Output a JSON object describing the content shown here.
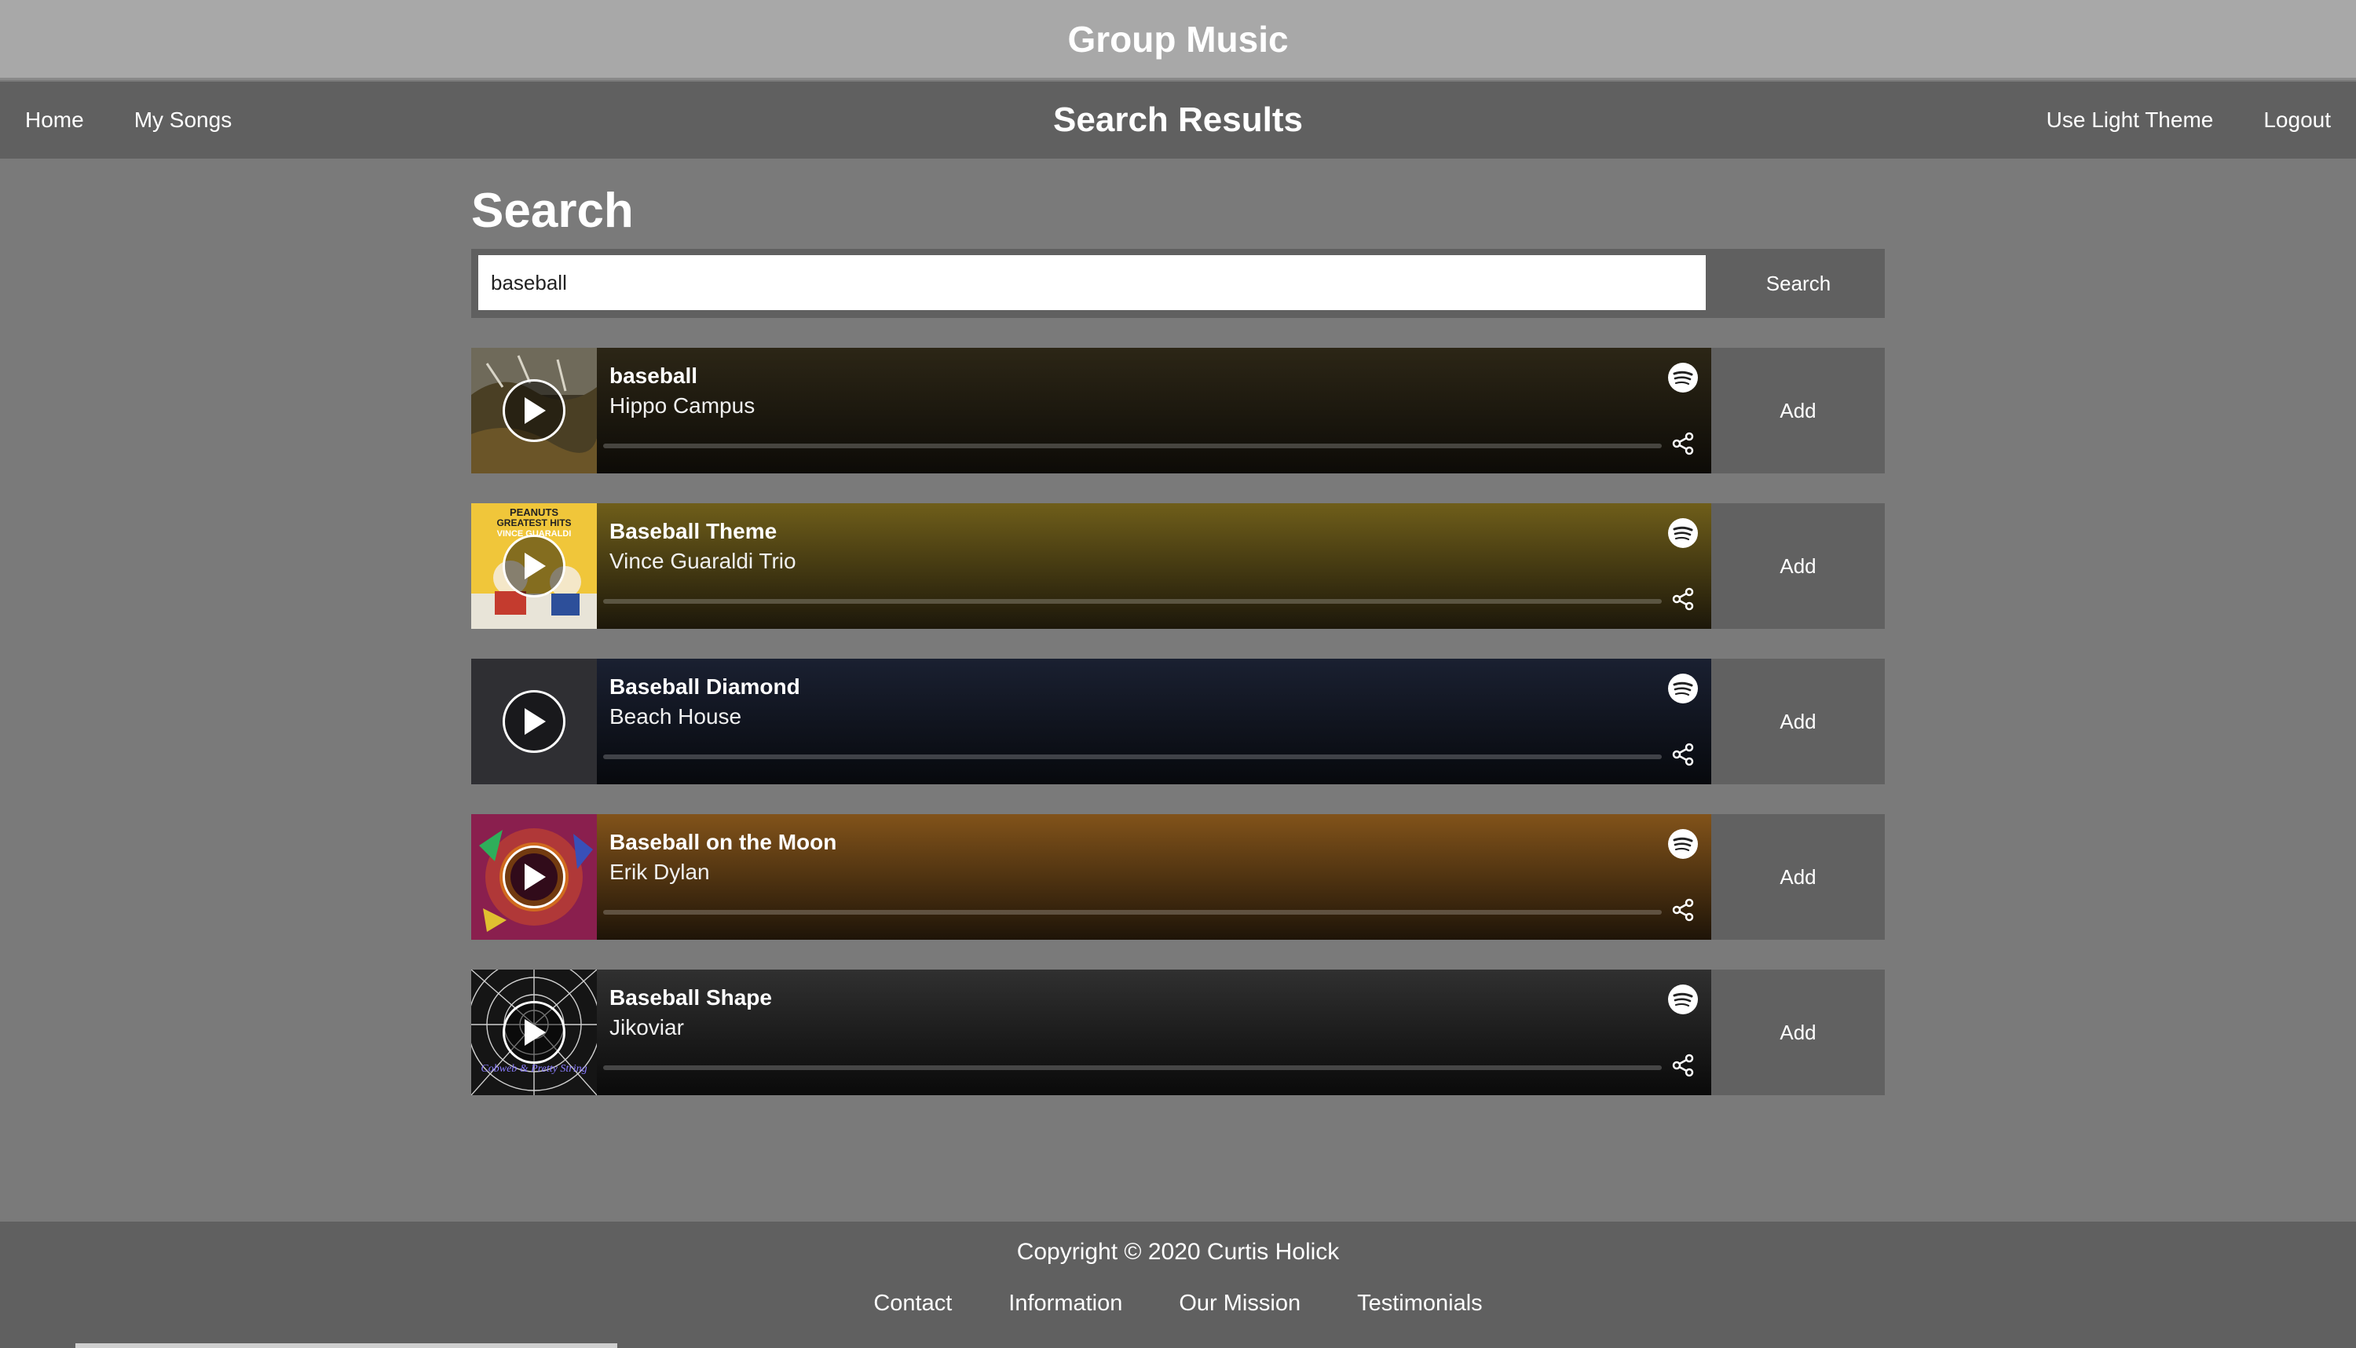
{
  "header": {
    "title": "Group Music"
  },
  "nav": {
    "left": [
      "Home",
      "My Songs"
    ],
    "page_title": "Search Results",
    "right": [
      "Use Light Theme",
      "Logout"
    ]
  },
  "search": {
    "heading": "Search",
    "query": "baseball",
    "button_label": "Search"
  },
  "results": [
    {
      "title": "baseball",
      "artist": "Hippo Campus",
      "bg": "#241e12",
      "add_label": "Add"
    },
    {
      "title": "Baseball Theme",
      "artist": "Vince Guaraldi Trio",
      "bg": "#6b5a18",
      "add_label": "Add"
    },
    {
      "title": "Baseball Diamond",
      "artist": "Beach House",
      "bg": "#151a2a",
      "add_label": "Add"
    },
    {
      "title": "Baseball on the Moon",
      "artist": "Erik Dylan",
      "bg": "#7a4e14",
      "add_label": "Add"
    },
    {
      "title": "Baseball Shape",
      "artist": "Jikoviar",
      "bg": "#2a2a2a",
      "add_label": "Add"
    }
  ],
  "album_art_text": {
    "peanuts_line1": "PEANUTS",
    "peanuts_line2": "GREATEST HITS",
    "peanuts_line3": "VINCE GUARALDI",
    "cobweb": "Cobweb & Pretty String"
  },
  "icons": {
    "play": "play-icon",
    "spotify": "spotify-icon",
    "share": "share-icon"
  },
  "footer": {
    "copyright": "Copyright © 2020 Curtis Holick",
    "links": [
      "Contact",
      "Information",
      "Our Mission",
      "Testimonials"
    ]
  }
}
